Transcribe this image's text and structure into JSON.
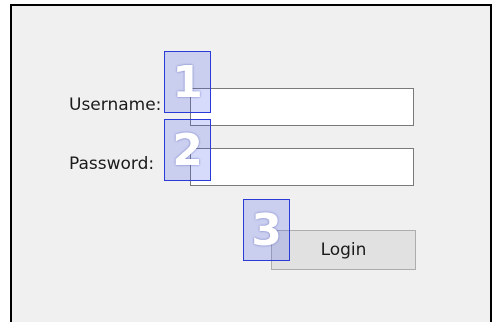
{
  "form": {
    "username_label": "Username:",
    "password_label": "Password:",
    "username_value": "",
    "password_value": "",
    "login_label": "Login"
  },
  "markers": [
    "1",
    "2",
    "3"
  ]
}
